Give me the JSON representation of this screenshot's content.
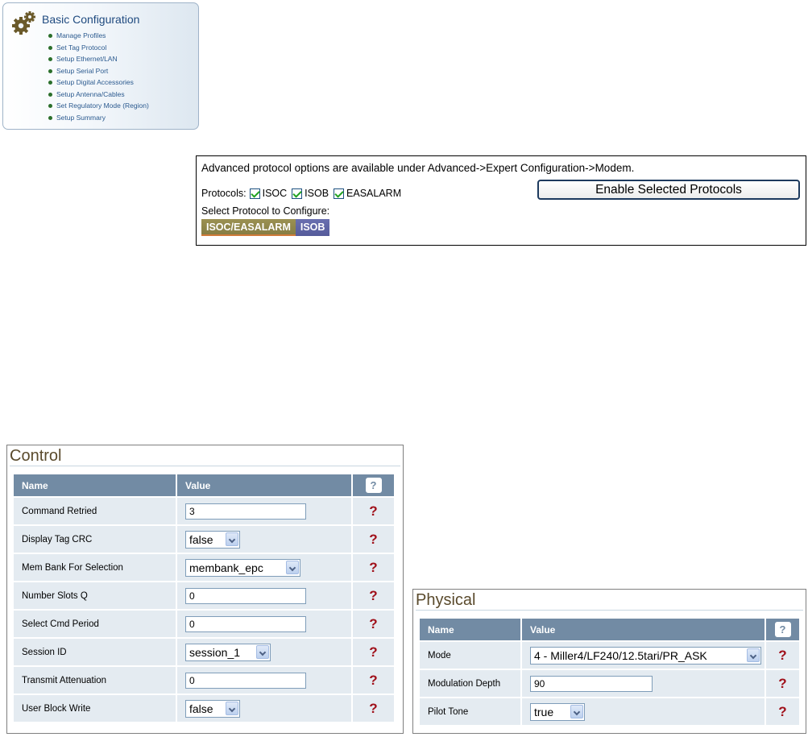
{
  "nav": {
    "title": "Basic Configuration",
    "items": [
      "Manage Profiles",
      "Set Tag Protocol",
      "Setup Ethernet/LAN",
      "Setup Serial Port",
      "Setup Digital Accessories",
      "Setup Antenna/Cables",
      "Set Regulatory Mode (Region)",
      "Setup Summary"
    ],
    "icon": "gears-icon"
  },
  "protocols": {
    "advanced_note": "Advanced protocol options are available under Advanced->Expert Configuration->Modem.",
    "label": "Protocols:",
    "options": [
      {
        "name": "ISOC",
        "checked": true
      },
      {
        "name": "ISOB",
        "checked": true
      },
      {
        "name": "EASALARM",
        "checked": true
      }
    ],
    "enable_button": "Enable Selected Protocols",
    "select_label": "Select Protocol to Configure:",
    "tabs": [
      "ISOC/EASALARM",
      "ISOB"
    ],
    "active_tab": "ISOC/EASALARM"
  },
  "control": {
    "title": "Control",
    "col_name": "Name",
    "col_value": "Value",
    "help_header": "?",
    "help_symbol": "?",
    "rows": [
      {
        "name": "Command Retried",
        "type": "text",
        "value": "3"
      },
      {
        "name": "Display Tag CRC",
        "type": "select",
        "value": "false"
      },
      {
        "name": "Mem Bank For Selection",
        "type": "select",
        "value": "membank_epc"
      },
      {
        "name": "Number Slots Q",
        "type": "text",
        "value": "0"
      },
      {
        "name": "Select Cmd Period",
        "type": "text",
        "value": "0"
      },
      {
        "name": "Session ID",
        "type": "select",
        "value": "session_1"
      },
      {
        "name": "Transmit Attenuation",
        "type": "text",
        "value": "0"
      },
      {
        "name": "User Block Write",
        "type": "select",
        "value": "false"
      }
    ]
  },
  "physical": {
    "title": "Physical",
    "col_name": "Name",
    "col_value": "Value",
    "help_header": "?",
    "help_symbol": "?",
    "rows": [
      {
        "name": "Mode",
        "type": "select",
        "value": "4 - Miller4/LF240/12.5tari/PR_ASK"
      },
      {
        "name": "Modulation Depth",
        "type": "text",
        "value": "90"
      },
      {
        "name": "Pilot Tone",
        "type": "select",
        "value": "true"
      }
    ]
  },
  "colors": {
    "header_bg": "#728ba4",
    "row_bg": "#e4ebf1",
    "help_red": "#a0101a",
    "panel_title": "#5a4a2c"
  }
}
